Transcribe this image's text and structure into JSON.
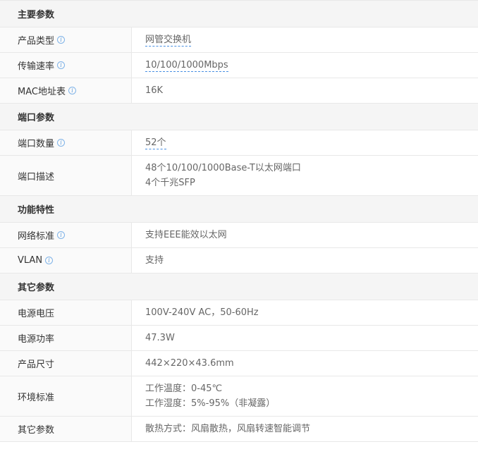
{
  "sections": [
    {
      "title": "主要参数",
      "rows": [
        {
          "label": "产品类型",
          "value": "网管交换机",
          "info": true,
          "link": true
        },
        {
          "label": "传输速率",
          "value": "10/100/1000Mbps",
          "info": true,
          "link": true
        },
        {
          "label": "MAC地址表",
          "value": "16K",
          "info": true,
          "link": false
        }
      ]
    },
    {
      "title": "端口参数",
      "rows": [
        {
          "label": "端口数量",
          "value": "52个",
          "info": true,
          "link": true
        },
        {
          "label": "端口描述",
          "value": "48个10/100/1000Base-T以太网端口",
          "value2": "4个千兆SFP",
          "info": false,
          "link": false
        }
      ]
    },
    {
      "title": "功能特性",
      "rows": [
        {
          "label": "网络标准",
          "value": "支持EEE能效以太网",
          "info": true,
          "link": false
        },
        {
          "label": "VLAN",
          "value": "支持",
          "info": true,
          "link": false
        }
      ]
    },
    {
      "title": "其它参数",
      "rows": [
        {
          "label": "电源电压",
          "value": "100V-240V AC，50-60Hz",
          "info": false,
          "link": false
        },
        {
          "label": "电源功率",
          "value": "47.3W",
          "info": false,
          "link": false
        },
        {
          "label": "产品尺寸",
          "value": "442×220×43.6mm",
          "info": false,
          "link": false
        },
        {
          "label": "环境标准",
          "value": "工作温度：0-45℃",
          "value2": "工作湿度：5%-95%（非凝露）",
          "info": false,
          "link": false
        },
        {
          "label": "其它参数",
          "value": "散热方式：风扇散热，风扇转速智能调节",
          "info": false,
          "link": false
        }
      ]
    }
  ],
  "info_icon_glyph": "i",
  "colors": {
    "section_bg": "#f5f5f5",
    "label_bg": "#fafafa",
    "border": "#e8e8e8",
    "link_underline": "#4a90e2",
    "info_icon": "#5b9bdb"
  }
}
